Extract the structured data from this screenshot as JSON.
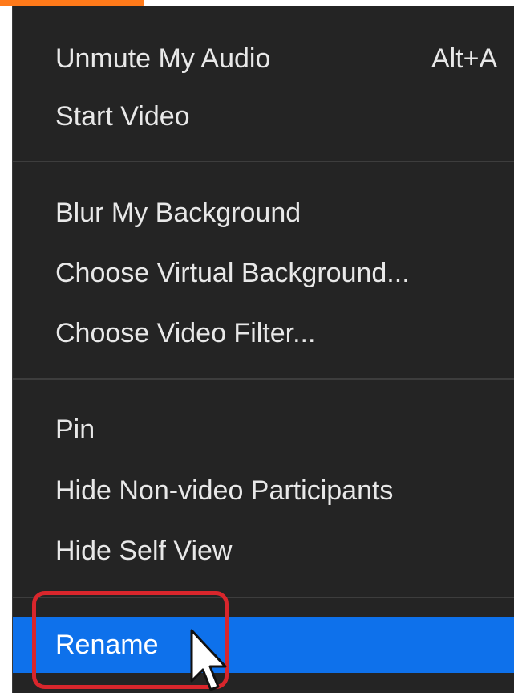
{
  "menu": {
    "groups": [
      {
        "items": [
          {
            "label": "Unmute My Audio",
            "shortcut": "Alt+A"
          },
          {
            "label": "Start Video"
          }
        ]
      },
      {
        "items": [
          {
            "label": "Blur My Background"
          },
          {
            "label": "Choose Virtual Background..."
          },
          {
            "label": "Choose Video Filter..."
          }
        ]
      },
      {
        "items": [
          {
            "label": "Pin"
          },
          {
            "label": "Hide Non-video Participants"
          },
          {
            "label": "Hide Self View"
          }
        ]
      },
      {
        "items": [
          {
            "label": "Rename",
            "highlighted": true
          }
        ]
      }
    ]
  },
  "colors": {
    "menu_background": "#242424",
    "menu_text": "#e8e8e8",
    "highlight": "#0e71eb",
    "callout_border": "#d9262c",
    "accent_strip": "#ff7a1a"
  },
  "icons": {
    "cursor": "mouse-pointer-icon"
  }
}
